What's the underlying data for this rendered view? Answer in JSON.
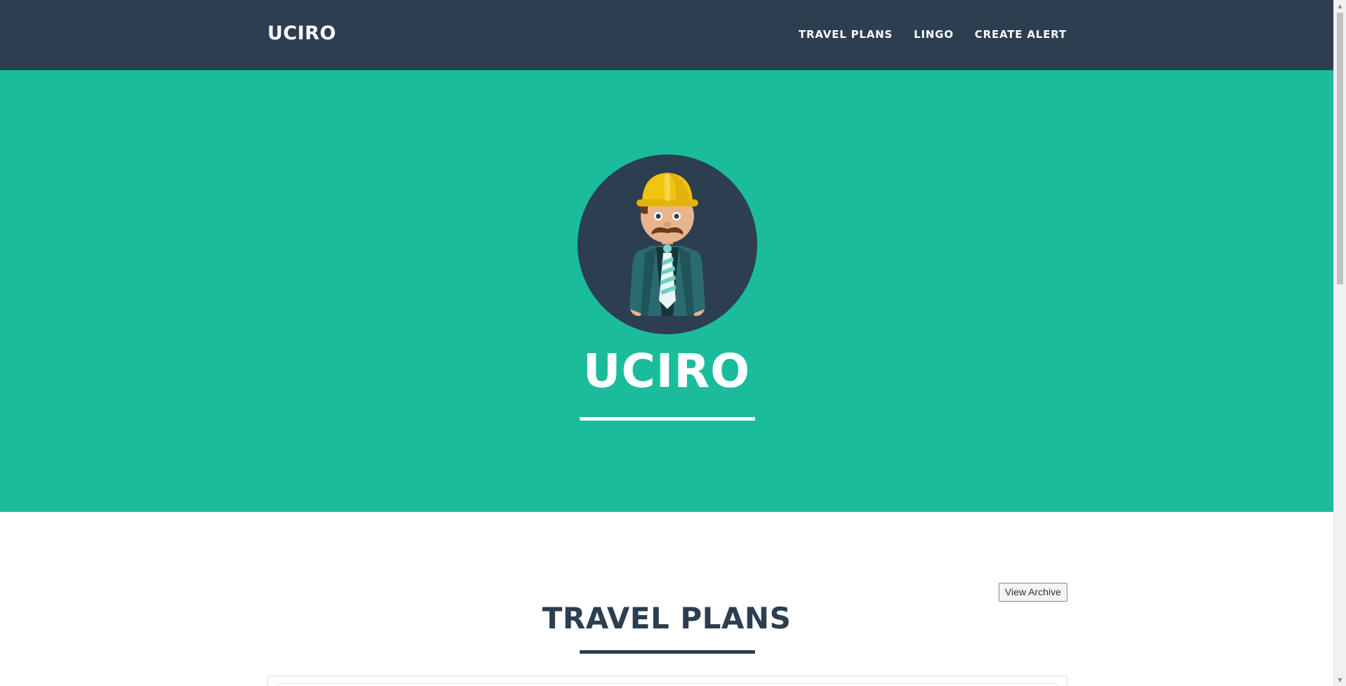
{
  "navbar": {
    "brand": "UCIRO",
    "links": [
      "TRAVEL PLANS",
      "LINGO",
      "CREATE ALERT"
    ]
  },
  "masthead": {
    "title": "UCIRO",
    "avatar_icon": "worker-avatar-icon"
  },
  "travel_plans": {
    "title": "TRAVEL PLANS",
    "archive_button": "View Archive"
  },
  "colors": {
    "navbar": "#2c3e50",
    "masthead": "#1abc9c",
    "text_light": "#ffffff",
    "text_dark": "#2c3e50"
  }
}
